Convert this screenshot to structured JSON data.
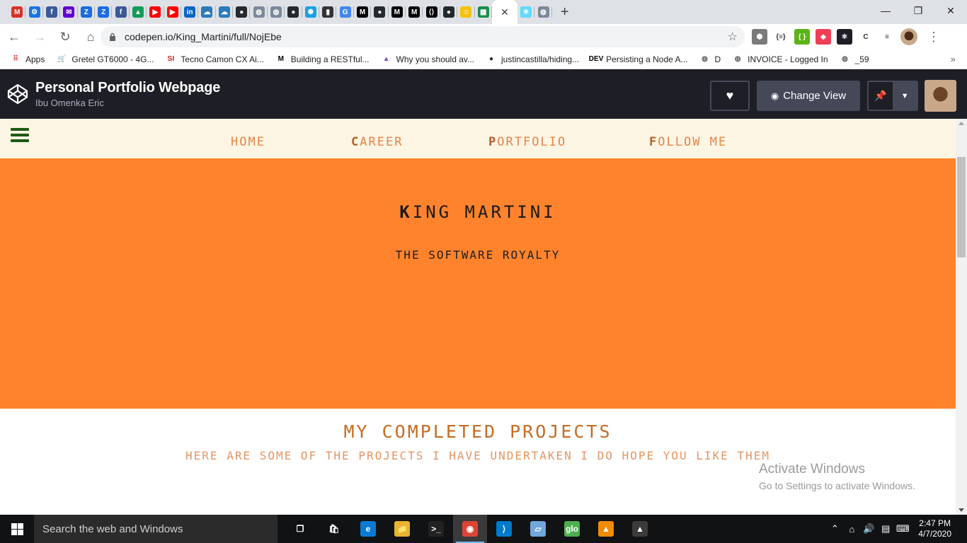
{
  "browser": {
    "tabs": [
      {
        "icon": "gmail-icon",
        "glyph": "M",
        "color": "#d93025"
      },
      {
        "icon": "settings-gear-tab-icon",
        "glyph": "⚙",
        "color": "#1a73e8"
      },
      {
        "icon": "facebook-icon",
        "glyph": "f",
        "color": "#3b5998"
      },
      {
        "icon": "yahoo-mail-icon",
        "glyph": "✉",
        "color": "#6001d2"
      },
      {
        "icon": "zoho-icon",
        "glyph": "Z",
        "color": "#1b6ce1"
      },
      {
        "icon": "zoho-icon",
        "glyph": "Z",
        "color": "#1b6ce1"
      },
      {
        "icon": "facebook-icon",
        "glyph": "f",
        "color": "#3b5998"
      },
      {
        "icon": "google-drive-icon",
        "glyph": "▲",
        "color": "#0f9d58"
      },
      {
        "icon": "youtube-icon",
        "glyph": "▶",
        "color": "#ff0000"
      },
      {
        "icon": "youtube-icon",
        "glyph": "▶",
        "color": "#ff0000"
      },
      {
        "icon": "linkedin-icon",
        "glyph": "in",
        "color": "#0a66c2"
      },
      {
        "icon": "cloud-app-icon",
        "glyph": "☁",
        "color": "#2b7bb9"
      },
      {
        "icon": "cloud-app-icon",
        "glyph": "☁",
        "color": "#2b7bb9"
      },
      {
        "icon": "github-icon",
        "glyph": "●",
        "color": "#24292e"
      },
      {
        "icon": "globe-icon",
        "glyph": "◍",
        "color": "#7b8a9a"
      },
      {
        "icon": "globe-icon",
        "glyph": "◍",
        "color": "#7b8a9a"
      },
      {
        "icon": "github-icon",
        "glyph": "●",
        "color": "#24292e"
      },
      {
        "icon": "virus-icon",
        "glyph": "✺",
        "color": "#1ba0e2"
      },
      {
        "icon": "chart-icon",
        "glyph": "▮",
        "color": "#333333"
      },
      {
        "icon": "google-icon",
        "glyph": "G",
        "color": "#4285f4"
      },
      {
        "icon": "medium-icon",
        "glyph": "M",
        "color": "#000000"
      },
      {
        "icon": "github-icon",
        "glyph": "●",
        "color": "#24292e"
      },
      {
        "icon": "medium-icon",
        "glyph": "M",
        "color": "#000000"
      },
      {
        "icon": "medium-icon",
        "glyph": "M",
        "color": "#000000"
      },
      {
        "icon": "code-icon",
        "glyph": "⟨⟩",
        "color": "#000000"
      },
      {
        "icon": "github-icon",
        "glyph": "●",
        "color": "#24292e"
      },
      {
        "icon": "emoji-icon",
        "glyph": "☺",
        "color": "#f4c20d"
      },
      {
        "icon": "green-app-icon",
        "glyph": "▦",
        "color": "#1b8e4a"
      }
    ],
    "active_tab": {
      "icon": "react-icon",
      "glyph": "⚛",
      "color": "#1e1f26"
    },
    "after_tabs": [
      {
        "icon": "react-icon",
        "glyph": "⚛",
        "color": "#61dafb"
      },
      {
        "icon": "globe-icon",
        "glyph": "◍",
        "color": "#7b8a9a"
      }
    ],
    "new_tab_glyph": "+",
    "close_tab_glyph": "✕",
    "window_controls": [
      "—",
      "❐",
      "✕"
    ],
    "url": "codepen.io/King_Martini/full/NojEbe",
    "extensions": [
      {
        "icon": "cube-extension-icon",
        "glyph": "⬢",
        "color": "#7a7a7a"
      },
      {
        "icon": "json-extension-icon",
        "glyph": "{≡}",
        "color": "#ffffff"
      },
      {
        "icon": "green-extension-icon",
        "glyph": "{ }",
        "color": "#5bb318"
      },
      {
        "icon": "pocket-extension-icon",
        "glyph": "◆",
        "color": "#ef3f56"
      },
      {
        "icon": "react-extension-icon",
        "glyph": "⚛",
        "color": "#1e1f26"
      },
      {
        "icon": "c-extension-icon",
        "glyph": "C",
        "color": "#ffffff"
      },
      {
        "icon": "playlist-extension-icon",
        "glyph": "≡",
        "color": "#ffffff"
      }
    ],
    "bookmarks": [
      {
        "label": "Apps",
        "icon": "apps-grid-icon",
        "glyph": "⠿",
        "color": "#d93025"
      },
      {
        "label": "Gretel GT6000 - 4G...",
        "icon": "cart-icon",
        "glyph": "🛒",
        "color": "#555555"
      },
      {
        "label": "Tecno Camon CX Ai...",
        "icon": "si-icon",
        "glyph": "SI",
        "color": "#d71920"
      },
      {
        "label": "Building a RESTful...",
        "icon": "medium-icon",
        "glyph": "M",
        "color": "#000000"
      },
      {
        "label": "Why you should av...",
        "icon": "rocket-icon",
        "glyph": "▲",
        "color": "#7e57c2"
      },
      {
        "label": "justincastilla/hiding...",
        "icon": "github-icon",
        "glyph": "●",
        "color": "#24292e"
      },
      {
        "label": "Persisting a Node A...",
        "icon": "dev-icon",
        "glyph": "DEV",
        "color": "#000000"
      },
      {
        "label": "D",
        "icon": "globe-icon",
        "glyph": "◍",
        "color": "#5f6368"
      },
      {
        "label": "INVOICE - Logged In",
        "icon": "globe-icon",
        "glyph": "◍",
        "color": "#5f6368"
      },
      {
        "label": "_59",
        "icon": "globe-icon",
        "glyph": "◍",
        "color": "#5f6368"
      }
    ],
    "bookmarks_more": "»"
  },
  "codepen": {
    "title": "Personal Portfolio Webpage",
    "author": "Ibu Omenka Eric",
    "change_view_label": "Change View"
  },
  "page": {
    "nav": [
      "Home",
      "Career",
      "Portfolio",
      "Follow Me"
    ],
    "hero_title": "King Martini",
    "hero_subtitle": "The Software Royalty",
    "projects_title": "My Completed Projects",
    "projects_subtitle": "Here are some of the projects I have undertaken I do hope you like them",
    "watermark_title": "Activate Windows",
    "watermark_subtitle": "Go to Settings to activate Windows.",
    "colors": {
      "hero_bg": "#ff832d",
      "nav_bg": "#fdf5e3",
      "accent": "#c46c26"
    }
  },
  "taskbar": {
    "search_placeholder": "Search the web and Windows",
    "apps": [
      {
        "icon": "task-view-icon",
        "glyph": "❐",
        "color": "#101214"
      },
      {
        "icon": "store-icon",
        "glyph": "🛍",
        "color": "#101214"
      },
      {
        "icon": "edge-icon",
        "glyph": "e",
        "color": "#0a7bd5"
      },
      {
        "icon": "file-explorer-icon",
        "glyph": "📁",
        "color": "#e8b330"
      },
      {
        "icon": "terminal-icon",
        "glyph": ">_",
        "color": "#222222"
      },
      {
        "icon": "chrome-icon",
        "glyph": "◉",
        "color": "#db4437"
      },
      {
        "icon": "vscode-icon",
        "glyph": "⟩",
        "color": "#007acc"
      },
      {
        "icon": "notepad-icon",
        "glyph": "▱",
        "color": "#6fa8dc"
      },
      {
        "icon": "glo-icon",
        "glyph": "glo",
        "color": "#4caf50"
      },
      {
        "icon": "vlc-icon",
        "glyph": "▲",
        "color": "#f28c00"
      },
      {
        "icon": "photos-icon",
        "glyph": "▲",
        "color": "#3b3b3b"
      }
    ],
    "time": "2:47 PM",
    "date": "4/7/2020"
  }
}
